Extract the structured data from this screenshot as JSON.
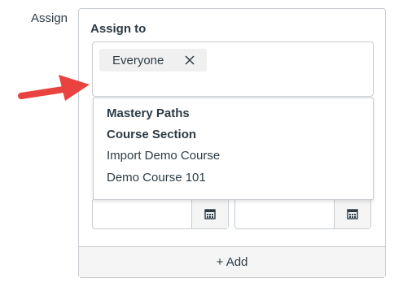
{
  "assign_label": "Assign",
  "assign_card": {
    "title": "Assign to",
    "selected_token": "Everyone",
    "dropdown_options": [
      {
        "label": "Mastery Paths",
        "kind": "group-header"
      },
      {
        "label": "Course Section",
        "kind": "group-header"
      },
      {
        "label": "Import Demo Course",
        "kind": "option"
      },
      {
        "label": "Demo Course 101",
        "kind": "option"
      }
    ],
    "add_button_label": "+ Add"
  },
  "icons": {
    "token_remove": "close-icon",
    "date_picker": "calendar-icon",
    "annotation": "red-arrow-icon"
  },
  "colors": {
    "border": "#c7cdd1",
    "text": "#2d3b45",
    "token_bg": "#f0f0f0",
    "arrow": "#e8433f"
  }
}
